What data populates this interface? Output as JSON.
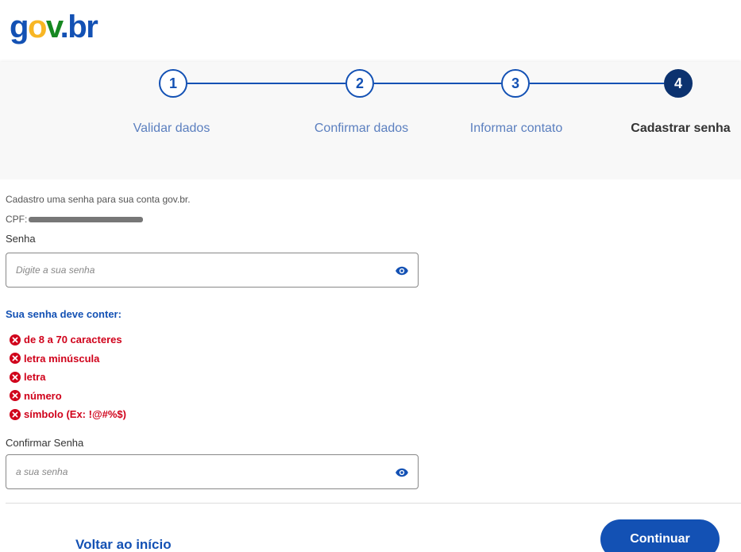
{
  "logo": {
    "g": "g",
    "o": "o",
    "v": "v",
    "dot": ".",
    "br": "br"
  },
  "steps": [
    {
      "number": "1",
      "label": "Validar dados"
    },
    {
      "number": "2",
      "label": "Confirmar dados"
    },
    {
      "number": "3",
      "label": "Informar contato"
    },
    {
      "number": "4",
      "label": "Cadastrar senha"
    }
  ],
  "active_step": 4,
  "form": {
    "intro": "Cadastro uma senha para sua conta gov.br.",
    "cpf_label": "CPF:",
    "password_label": "Senha",
    "password_placeholder": "Digite a sua senha",
    "rules_title": "Sua senha deve conter:",
    "rules": [
      "de 8 a 70 caracteres",
      "letra minúscula",
      "letra",
      "número",
      "símbolo (Ex: !@#%$)"
    ],
    "confirm_label": "Confirmar Senha",
    "confirm_placeholder": "a sua senha"
  },
  "footer": {
    "back_label": "Voltar ao início",
    "continue_label": "Continuar"
  },
  "colors": {
    "primary": "#1351b4",
    "active_step": "#0c326f",
    "error": "#d0021b",
    "logo_yellow": "#f8b624",
    "logo_green": "#168821"
  },
  "icons": {
    "eye": "eye-icon",
    "rule_status": "x-circle-icon"
  }
}
